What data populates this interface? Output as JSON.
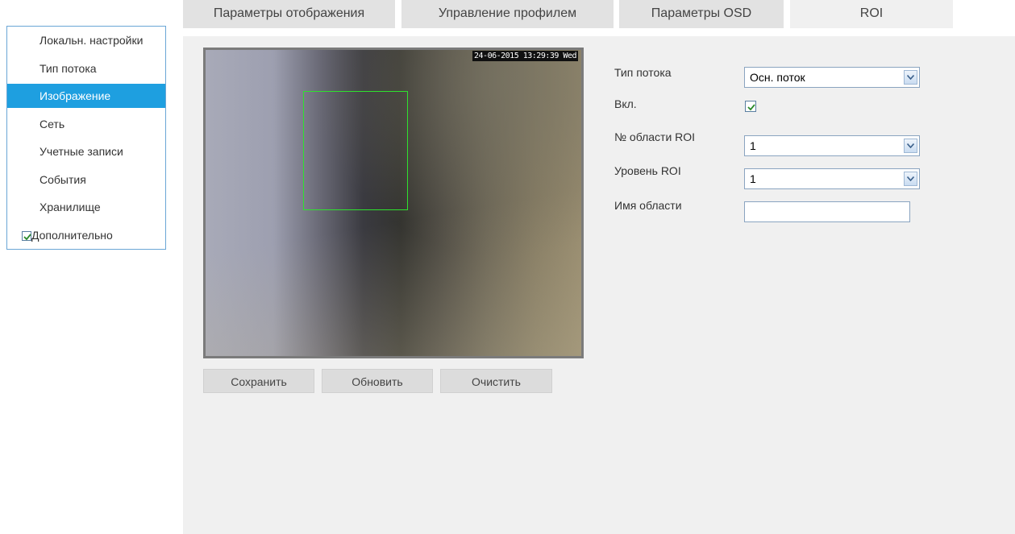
{
  "sidebar": {
    "items": [
      {
        "label": "Локальн. настройки"
      },
      {
        "label": "Тип потока"
      },
      {
        "label": "Изображение"
      },
      {
        "label": "Сеть"
      },
      {
        "label": "Учетные записи"
      },
      {
        "label": "События"
      },
      {
        "label": "Хранилище"
      },
      {
        "label": "Дополнительно",
        "checked": true
      }
    ],
    "active_index": 2
  },
  "tabs": [
    {
      "label": "Параметры отображения"
    },
    {
      "label": "Управление профилем"
    },
    {
      "label": "Параметры OSD"
    },
    {
      "label": "ROI"
    }
  ],
  "active_tab": "ROI",
  "video": {
    "osd_text": "24-06-2015 13:29:39 Wed"
  },
  "form": {
    "stream_type": {
      "label": "Тип потока",
      "value": "Осн. поток"
    },
    "enabled": {
      "label": "Вкл.",
      "checked": true
    },
    "roi_area": {
      "label": "№ области ROI",
      "value": "1"
    },
    "roi_level": {
      "label": "Уровень ROI",
      "value": "1"
    },
    "area_name": {
      "label": "Имя области",
      "value": ""
    }
  },
  "buttons": {
    "save": "Сохранить",
    "refresh": "Обновить",
    "clear": "Очистить"
  },
  "colors": {
    "accent": "#1e9fe0",
    "roi_box": "#2ee22e",
    "panel_bg": "#f0f0f0"
  }
}
